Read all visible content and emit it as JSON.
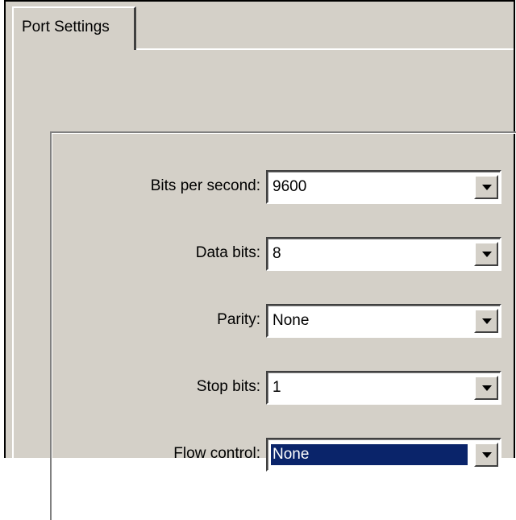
{
  "tab": {
    "label": "Port Settings"
  },
  "fields": [
    {
      "label": "Bits per second:",
      "value": "9600",
      "focused": false
    },
    {
      "label": "Data bits:",
      "value": "8",
      "focused": false
    },
    {
      "label": "Parity:",
      "value": "None",
      "focused": false
    },
    {
      "label": "Stop bits:",
      "value": "1",
      "focused": false
    },
    {
      "label": "Flow control:",
      "value": "None",
      "focused": true
    }
  ],
  "colors": {
    "selection": "#0a246a",
    "face": "#d4d0c8"
  },
  "icons": {
    "dropdown": "chevron-down-icon"
  }
}
